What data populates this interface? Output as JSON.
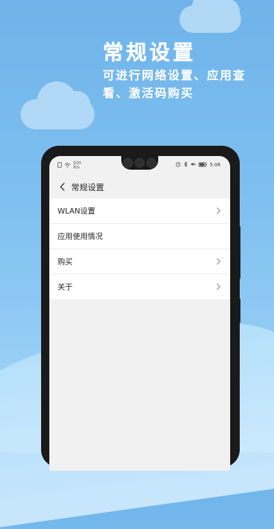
{
  "promo": {
    "headline": "常规设置",
    "subline": "可进行网络设置、应用查看、激活码购买"
  },
  "statusbar": {
    "speed_value": "930",
    "speed_unit": "B/s",
    "time": "5:06"
  },
  "topbar": {
    "title": "常规设置"
  },
  "settings": {
    "items": [
      {
        "label": "WLAN设置",
        "chevron": true
      },
      {
        "label": "应用使用情况",
        "chevron": false
      },
      {
        "label": "购买",
        "chevron": true
      },
      {
        "label": "关于",
        "chevron": true
      }
    ]
  },
  "icons": {
    "back": "chevron-left-icon",
    "chevron": "chevron-right-icon"
  }
}
